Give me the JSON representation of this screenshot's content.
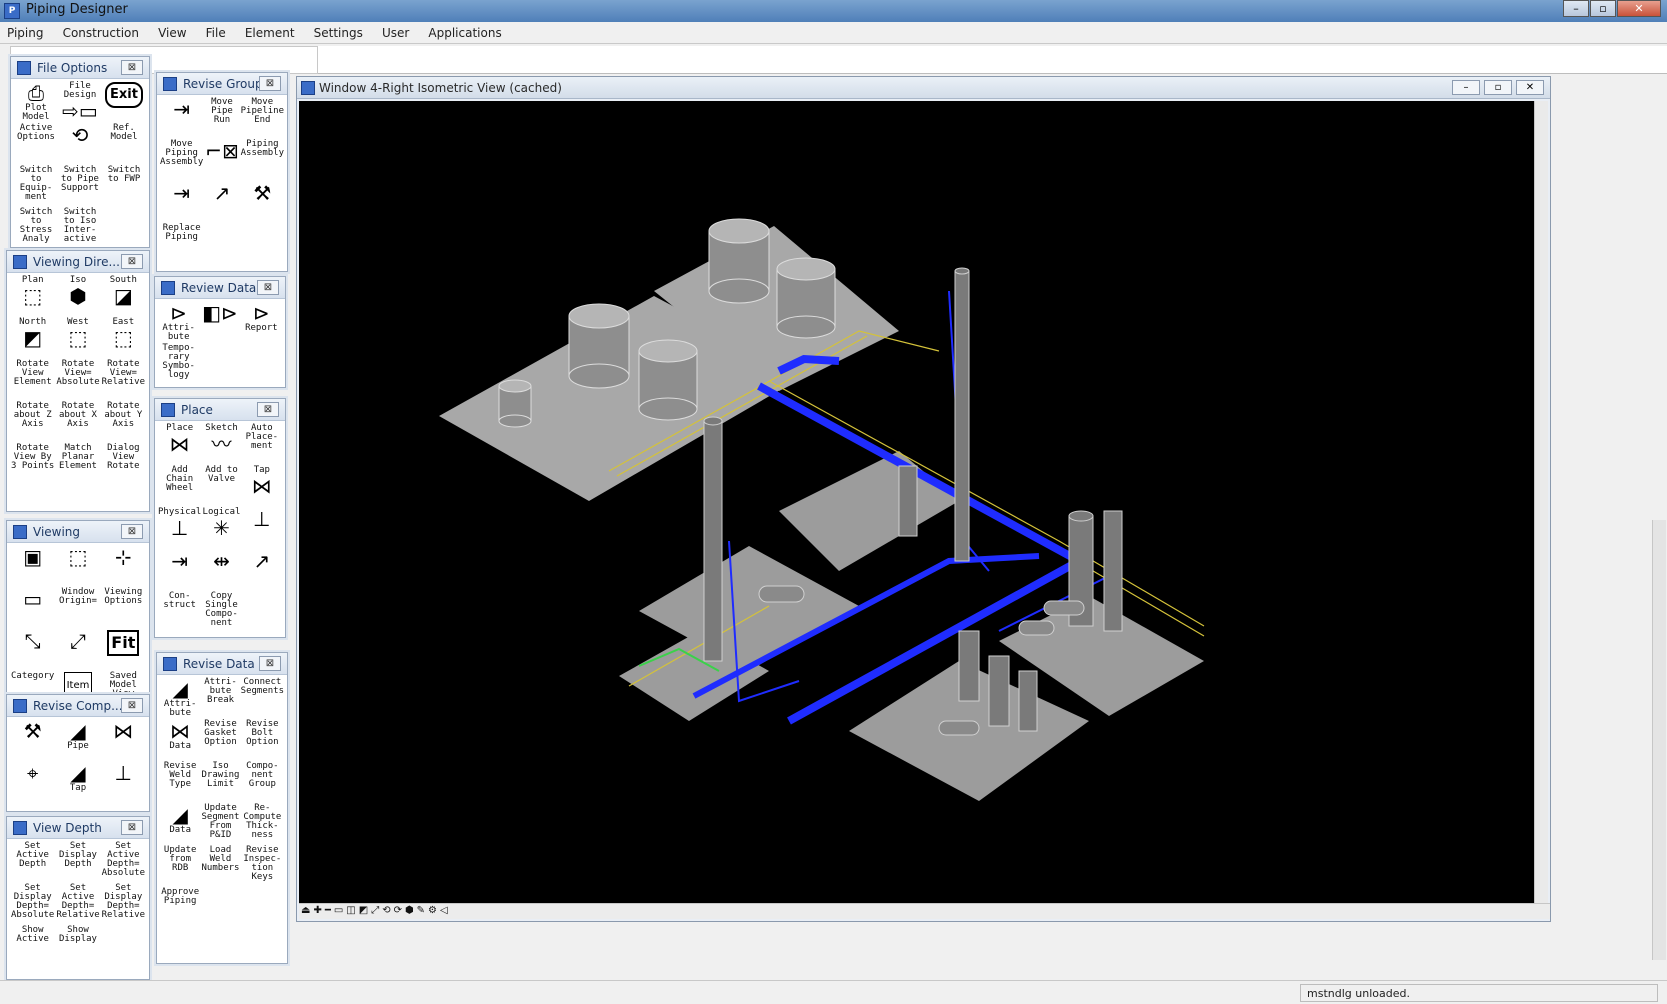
{
  "window": {
    "title": "Piping Designer",
    "controls": [
      "–",
      "▫",
      "✕"
    ]
  },
  "menu": [
    "Piping",
    "Construction",
    "View",
    "File",
    "Element",
    "Settings",
    "User",
    "Applications"
  ],
  "panels": {
    "file_options": {
      "title": "File Options",
      "items": [
        "Plot Model",
        "File Design",
        "Exit",
        "Active Options",
        "",
        "Ref. Model",
        "Switch to Equip-ment",
        "Switch to Pipe Support",
        "Switch to FWP",
        "Switch to Stress Analy",
        "Switch to Iso Inter-active",
        ""
      ]
    },
    "viewing_dir": {
      "title": "Viewing Dire...",
      "items": [
        "Plan",
        "Iso",
        "South",
        "North",
        "West",
        "East",
        "Rotate View Element",
        "Rotate View= Absolute",
        "Rotate View= Relative",
        "Rotate about Z Axis",
        "Rotate about X Axis",
        "Rotate about Y Axis",
        "Rotate View By 3 Points",
        "Match Planar Element",
        "Dialog View Rotate"
      ]
    },
    "viewing": {
      "title": "Viewing",
      "items": [
        "",
        "",
        "",
        "",
        "Window Origin=",
        "Viewing Options",
        "",
        "",
        "Fit",
        "Category",
        "Item",
        "Saved Model View"
      ]
    },
    "revise_comp": {
      "title": "Revise Comp...",
      "items": [
        "",
        "Pipe",
        "",
        "",
        "Tap",
        ""
      ]
    },
    "view_depth": {
      "title": "View Depth",
      "items": [
        "Set Active Depth",
        "Set Display Depth",
        "Set Active Depth= Absolute",
        "Set Display Depth= Absolute",
        "Set Active Depth= Relative",
        "Set Display Depth= Relative",
        "Show Active",
        "Show Display",
        ""
      ]
    },
    "revise_group": {
      "title": "Revise Group",
      "items": [
        "",
        "Move Pipe Run",
        "Move Pipeline End",
        "Move Piping Assembly",
        "",
        "Piping Assembly",
        "",
        "",
        "",
        "Replace Piping",
        "",
        ""
      ]
    },
    "review_data": {
      "title": "Review Data",
      "items": [
        "Attri-bute",
        "",
        "Report",
        "Tempo-rary Symbo-logy",
        "",
        ""
      ]
    },
    "place": {
      "title": "Place",
      "items": [
        "Place",
        "Sketch",
        "Auto Place-ment",
        "Add Chain Wheel",
        "Add to Valve",
        "Tap",
        "Physical",
        "Logical",
        "",
        "",
        "",
        "",
        "Con-struct",
        "Copy Single Compo-nent",
        ""
      ]
    },
    "revise_data": {
      "title": "Revise Data",
      "items": [
        "Attri-bute",
        "Attri-bute Break",
        "Connect Segments",
        "Data",
        "Revise Gasket Option",
        "Revise Bolt Option",
        "Revise Weld Type",
        "Iso Drawing Limit",
        "Compo-nent Group",
        "Data",
        "Update Segment From P&ID",
        "Re-Compute Thick-ness",
        "Update from RDB",
        "Load Weld Numbers",
        "Revise Inspec-tion Keys",
        "Approve Piping",
        "",
        ""
      ]
    }
  },
  "graphics": {
    "title": "Window 4-Right Isometric View (cached)",
    "controls": [
      "–",
      "▫",
      "✕"
    ]
  },
  "status": {
    "message": "mstndlg unloaded."
  },
  "colors": {
    "canvas": "#000000",
    "pipe": "#1f2cff",
    "slab": "#a9a9a9",
    "steel": "#d4c23a",
    "accent_green": "#3bd14a"
  }
}
